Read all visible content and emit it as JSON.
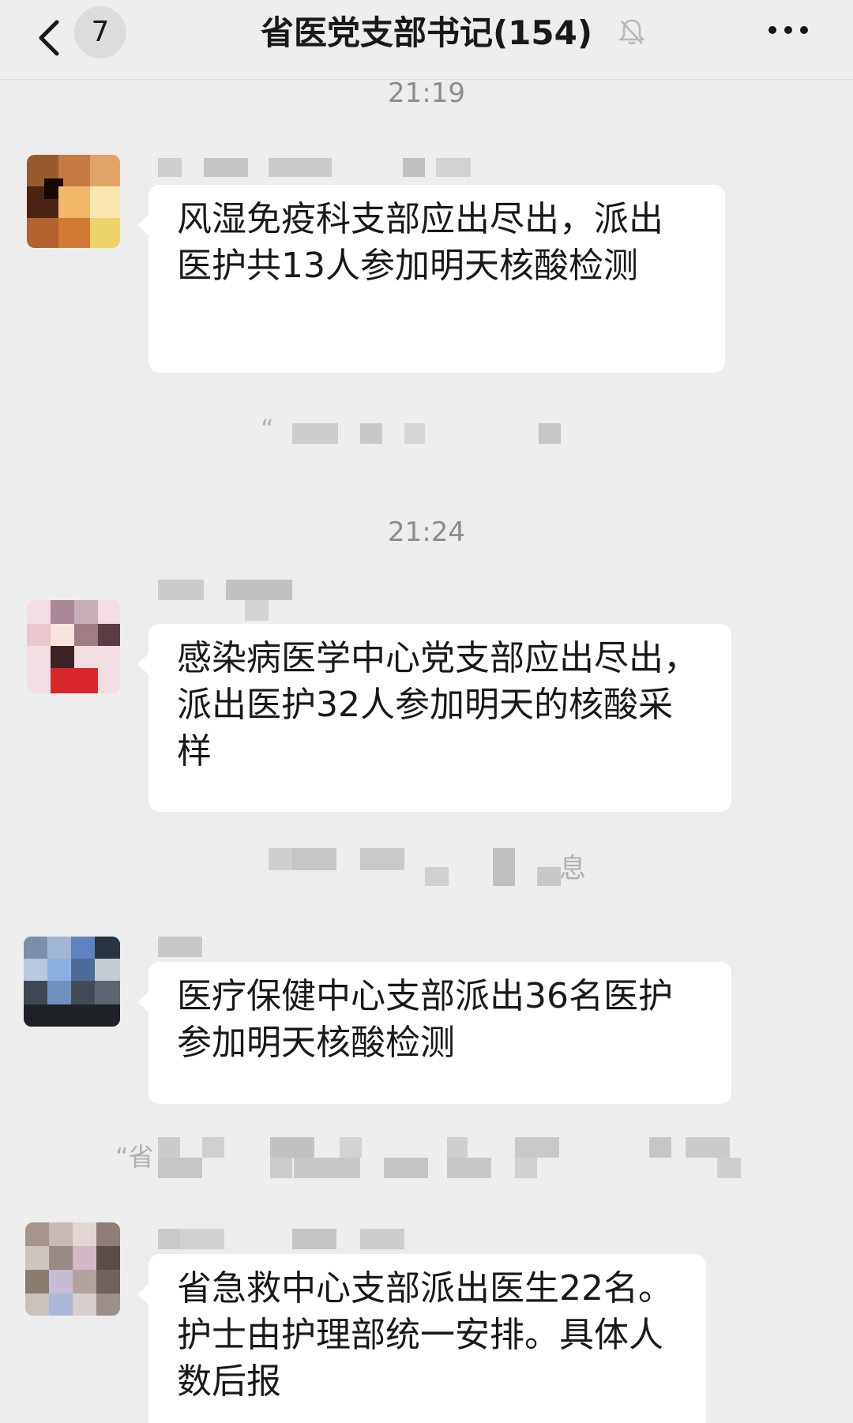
{
  "header": {
    "back_icon": "chevron-left-icon",
    "unread_count": "7",
    "title": "省医党支部书记(154)",
    "mute_icon": "bell-off-icon",
    "more_icon": "more-dots-icon"
  },
  "messages": [
    {
      "time": "21:19",
      "text": "风湿免疫科支部应出尽出，派出医护共13人参加明天核酸检测"
    },
    {
      "time": "21:24",
      "text": "感染病医学中心党支部应出尽出，派出医护32人参加明天的核酸采样"
    },
    {
      "text": "医疗保健中心支部派出36名医护参加明天核酸检测"
    },
    {
      "text": "省急救中心支部派出医生22名。护士由护理部统一安排。具体人数后报"
    }
  ],
  "system_fragments": {
    "quote_mark_1": "“",
    "xi": "息",
    "quote_sheng": "“省"
  },
  "colors": {
    "background": "#ededed",
    "bubble": "#ffffff",
    "time_text": "#8c8c8c",
    "mosaic": "#d0d0d0"
  }
}
